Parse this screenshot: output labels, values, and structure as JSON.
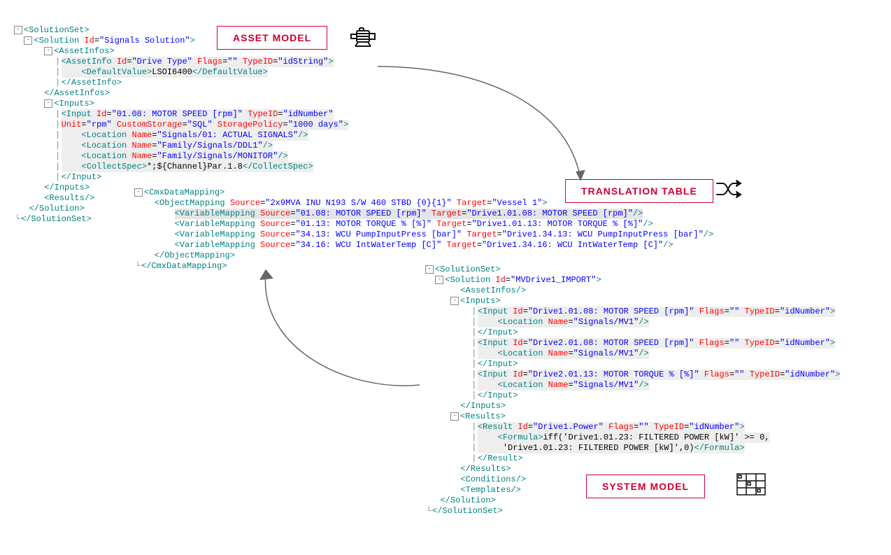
{
  "labels": {
    "asset_model": "ASSET MODEL",
    "translation_table": "TRANSLATION TABLE",
    "system_model": "SYSTEM MODEL"
  },
  "xml1": {
    "root_open": "SolutionSet",
    "solution_id": "Signals Solution",
    "assetinfos": "AssetInfos",
    "assetinfo_id": "Drive Type",
    "assetinfo_flags": "",
    "assetinfo_typeid": "idString",
    "default_value": "LSOI6400",
    "inputs": "Inputs",
    "input_id": "01.08: MOTOR SPEED [rpm]",
    "input_typeid": "idNumber",
    "input_unit": "rpm",
    "input_custom": "SQL",
    "input_policy": "1000 days",
    "loc1": "Signals/01:  ACTUAL SIGNALS",
    "loc2": "Family/Signals/DDL1",
    "loc3": "Family/Signals/MONITOR",
    "collectspec": "*;${Channel}Par.1.8",
    "results": "Results"
  },
  "xml2": {
    "root": "CmxDataMapping",
    "objmap_src": "2x9MVA INU N193 S/W 460 STBD {0}{1}",
    "objmap_tgt": "Vessel 1",
    "vm1_src": "01.08: MOTOR SPEED [rpm]",
    "vm1_tgt": "Drive1.01.08: MOTOR SPEED [rpm]",
    "vm2_src": "01.13: MOTOR TORQUE % [%]",
    "vm2_tgt": "Drive1.01.13: MOTOR TORQUE % [%]",
    "vm3_src": "34.13: WCU PumpInputPress [bar]",
    "vm3_tgt": "Drive1.34.13: WCU PumpInputPress [bar]",
    "vm4_src": "34.16: WCU IntWaterTemp [C]",
    "vm4_tgt": "Drive1.34.16: WCU IntWaterTemp [C]"
  },
  "xml3": {
    "root": "SolutionSet",
    "solution_id": "MVDrive1_IMPORT",
    "assetinfos": "AssetInfos",
    "inputs": "Inputs",
    "in1_id": "Drive1.01.08: MOTOR SPEED [rpm]",
    "in1_flags": "",
    "in1_typeid": "idNumber",
    "loc_name": "Signals/MV1",
    "in2_id": "Drive2.01.08: MOTOR SPEED [rpm]",
    "in3_id": "Drive2.01.13: MOTOR TORQUE % [%]",
    "results": "Results",
    "result_id": "Drive1.Power",
    "result_flags": "",
    "result_typeid": "idNumber",
    "formula1": "iff('Drive1.01.23: FILTERED POWER [kW]' >= 0,",
    "formula2": "'Drive1.01.23: FILTERED POWER [kW]',0)",
    "conditions": "Conditions",
    "templates": "Templates"
  }
}
